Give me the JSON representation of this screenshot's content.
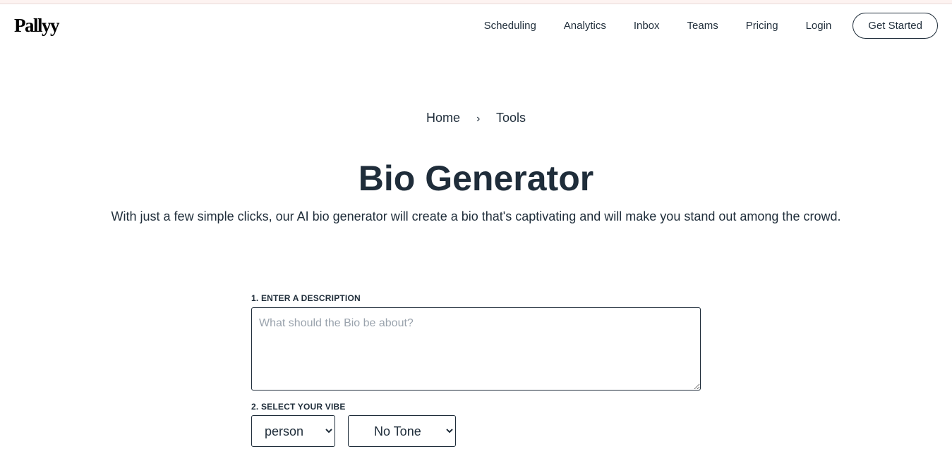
{
  "brand": {
    "logo": "Pallyy"
  },
  "nav": {
    "items": [
      "Scheduling",
      "Analytics",
      "Inbox",
      "Teams",
      "Pricing",
      "Login"
    ],
    "cta": "Get Started"
  },
  "breadcrumb": {
    "home": "Home",
    "separator": "›",
    "current": "Tools"
  },
  "hero": {
    "title": "Bio Generator",
    "subtitle": "With just a few simple clicks, our AI bio generator will create a bio that's captivating and will make you stand out among the crowd."
  },
  "form": {
    "description_label": "1. ENTER A DESCRIPTION",
    "description_placeholder": "What should the Bio be about?",
    "description_value": "",
    "vibe_label": "2. SELECT YOUR VIBE",
    "vibe_type": "person",
    "tone": "No Tone"
  }
}
